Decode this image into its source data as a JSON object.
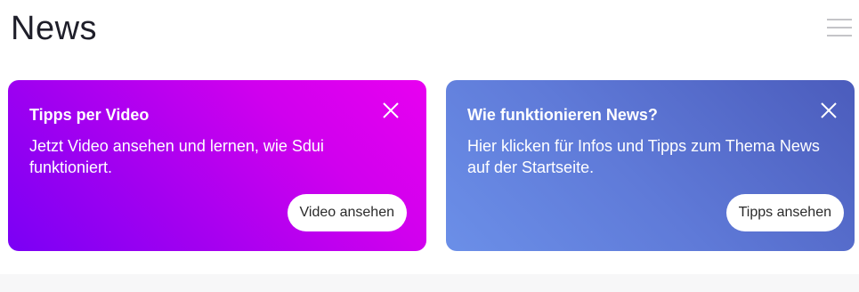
{
  "header": {
    "title": "News",
    "menu_icon": "hamburger-menu-icon"
  },
  "cards": [
    {
      "title": "Tipps per Video",
      "text": "Jetzt Video ansehen und lernen, wie Sdui funktioniert.",
      "button_label": "Video ansehen",
      "close_icon": "close-icon",
      "colors": [
        "#7a00f5",
        "#e800f0"
      ]
    },
    {
      "title": "Wie funktionieren News?",
      "text": "Hier klicken für Infos und Tipps zum Thema News auf der Startseite.",
      "button_label": "Tipps ansehen",
      "close_icon": "close-icon",
      "colors": [
        "#6b8fe8",
        "#4b5cbc"
      ]
    }
  ]
}
